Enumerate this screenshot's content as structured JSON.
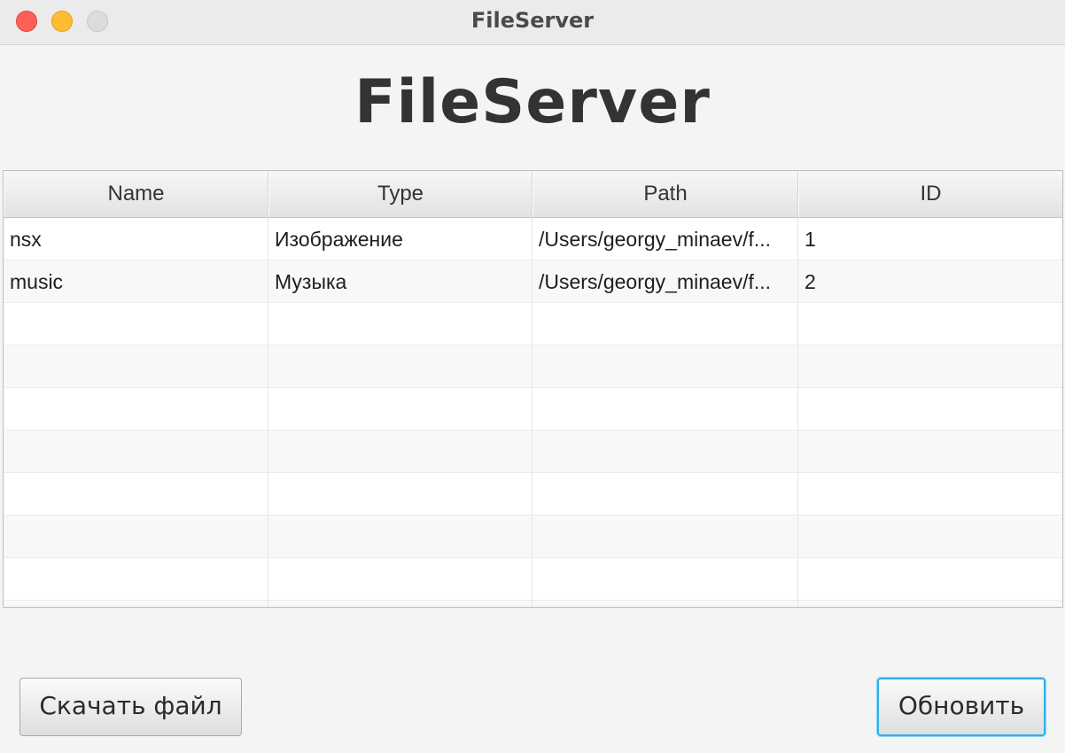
{
  "window": {
    "title": "FileServer"
  },
  "heading": "FileServer",
  "table": {
    "columns": [
      "Name",
      "Type",
      "Path",
      "ID"
    ],
    "rows": [
      [
        "nsx",
        "Изображение",
        "/Users/georgy_minaev/f...",
        "1"
      ],
      [
        "music",
        "Музыка",
        "/Users/georgy_minaev/f...",
        "2"
      ]
    ]
  },
  "buttons": {
    "download_label": "Скачать файл",
    "refresh_label": "Обновить"
  },
  "colors": {
    "close": "#fe5f57",
    "minimize": "#febc2e",
    "zoom_disabled": "#dcdcdc",
    "focus_ring": "#2fb2e6"
  }
}
